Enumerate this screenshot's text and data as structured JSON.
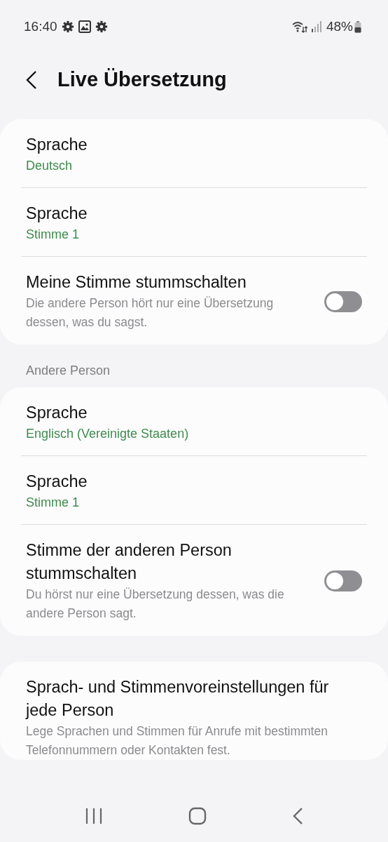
{
  "status_bar": {
    "time": "16:40",
    "battery": "48%"
  },
  "header": {
    "title": "Live Übersetzung"
  },
  "groups": [
    {
      "items": [
        {
          "kind": "value",
          "title": "Sprache",
          "value": "Deutsch"
        },
        {
          "kind": "value",
          "title": "Sprache",
          "value": "Stimme 1"
        },
        {
          "kind": "switch",
          "title": "Meine Stimme stummschalten",
          "description": "Die andere Person hört nur eine Übersetzung dessen, was du sagst.",
          "on": false
        }
      ]
    },
    {
      "heading": "Andere Person",
      "items": [
        {
          "kind": "value",
          "title": "Sprache",
          "value": "Englisch (Vereinigte Staaten)"
        },
        {
          "kind": "value",
          "title": "Sprache",
          "value": "Stimme 1"
        },
        {
          "kind": "switch",
          "title": "Stimme der anderen Person stummschalten",
          "description": "Du hörst nur eine Übersetzung dessen, was die andere Person sagt.",
          "on": false
        }
      ]
    },
    {
      "items": [
        {
          "kind": "text",
          "title": "Sprach- und Stimmenvoreinstellungen für jede Person",
          "description": "Lege Sprachen und Stimmen für Anrufe mit bestimmten Telefonnummern oder Kontakten fest."
        }
      ]
    }
  ]
}
